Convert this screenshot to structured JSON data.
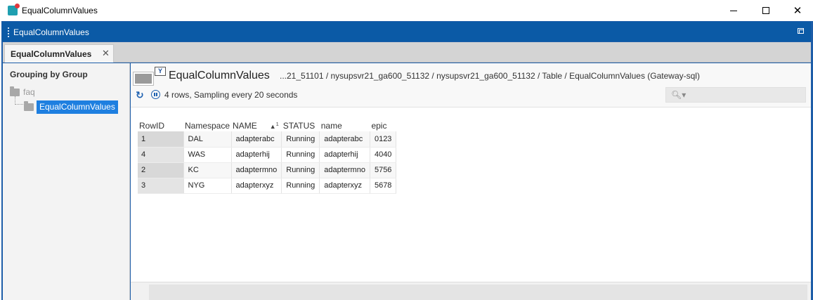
{
  "window": {
    "title": "EqualColumnValues"
  },
  "inner_window": {
    "title": "EqualColumnValues"
  },
  "tab": {
    "label": "EqualColumnValues",
    "close": "✕"
  },
  "sidebar": {
    "heading": "Grouping by Group",
    "tree": {
      "group": "faq",
      "selected_item": "EqualColumnValues"
    }
  },
  "panel": {
    "title": "EqualColumnValues",
    "path": "...21_51101 / nysupsvr21_ga600_51132 / nysupsvr21_ga600_51132 / Table / EqualColumnValues (Gateway-sql)",
    "status": "4 rows, Sampling every 20 seconds",
    "search_placeholder": ""
  },
  "table": {
    "columns": [
      "RowID",
      "Namespace",
      "NAME",
      "STATUS",
      "name",
      "epic"
    ],
    "sort": {
      "column": "NAME",
      "order": "1"
    },
    "rows": [
      {
        "rowid": "1",
        "namespace": "DAL",
        "NAME": "adapterabc",
        "status": "Running",
        "name": "adapterabc",
        "epic": "0123"
      },
      {
        "rowid": "4",
        "namespace": "WAS",
        "NAME": "adapterhij",
        "status": "Running",
        "name": "adapterhij",
        "epic": "4040"
      },
      {
        "rowid": "2",
        "namespace": "KC",
        "NAME": "adaptermno",
        "status": "Running",
        "name": "adaptermno",
        "epic": "5756"
      },
      {
        "rowid": "3",
        "namespace": "NYG",
        "NAME": "adapterxyz",
        "status": "Running",
        "name": "adapterxyz",
        "epic": "5678"
      }
    ]
  },
  "colors": {
    "accent": "#0b5aa6",
    "selection": "#1e7fe0",
    "icon_blue": "#1b5fb0"
  }
}
